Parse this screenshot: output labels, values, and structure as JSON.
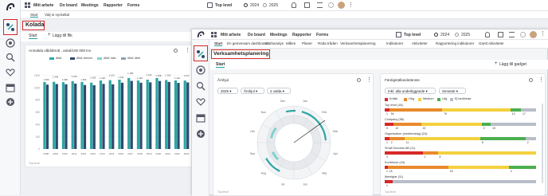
{
  "colors": {
    "teal": "#2ca6a4",
    "teal_light": "#7fd3cf",
    "navy": "#2f4a6d",
    "grey": "#8da0b8",
    "red": "#d62828",
    "yellow": "#f4d03f",
    "orange": "#e98a2c",
    "green": "#4caf50",
    "bar_grey": "#b7bec8"
  },
  "back_window": {
    "nav": [
      "Mitt arbete",
      "Do board",
      "Meetings",
      "Rapporter",
      "Forms"
    ],
    "top_level": "Top level",
    "year_a": "2024",
    "year_b": "2025",
    "tabs": [
      "Start",
      "Välj in nyckeltal"
    ],
    "kolada_label": "Kolada",
    "start_tab": "Start",
    "add_tile": "Lägg till flik",
    "chart_title": "Anmälda våldsbrott , antal/100 000 inv",
    "chart_footer": "Top level",
    "legend": [
      "Alla1",
      "Alla1 kvinnor",
      "Alla1 män",
      "Alla1 diver"
    ]
  },
  "chart_data": {
    "type": "bar",
    "title": "Anmälda våldsbrott , antal/100 000 inv",
    "categories": [
      "2008",
      "2009",
      "2010",
      "2011",
      "2012",
      "2013",
      "2014",
      "2015",
      "2016",
      "2017",
      "2018",
      "2019",
      "2020",
      "2021",
      "2022",
      "2023"
    ],
    "series": [
      {
        "name": "Alla1",
        "values": [
          1093,
          1096,
          1090,
          1105,
          1094,
          1083,
          1118,
          1123,
          1131,
          1158,
          1118,
          1131,
          1158,
          1126,
          1119,
          1117
        ]
      },
      {
        "name": "Alla1 kvinnor",
        "values": [
          1050,
          1060,
          1056,
          1067,
          1044,
          1040,
          1062,
          1055,
          1081,
          1111,
          1081,
          1087,
          1110,
          1094,
          1078,
          1086
        ]
      }
    ],
    "data_labels": [
      "1 093",
      "1 096",
      "1 090",
      "1 105",
      "1 094",
      "1 083",
      "1 118",
      "1 123",
      "1 131",
      "1 158",
      "1 118",
      "1 131",
      "1 158",
      "1 126",
      "1 119",
      "1 117"
    ],
    "ylim": [
      0,
      1300
    ],
    "grid": true,
    "legend": "top"
  },
  "front_window": {
    "nav": [
      "Mitt arbete",
      "Do board",
      "Meetings",
      "Rapporter",
      "Forms"
    ],
    "top_level": "Top level",
    "year_a": "2024",
    "year_b": "2025",
    "tabs": [
      "Start",
      "En gemensam dashboard",
      "Mathanalys",
      "Målen",
      "Planer",
      "Röda tråden",
      "Verksamhetsplanering",
      "Indikatorer",
      "Aktiviteter",
      "Rapportering indikatorer",
      "Gantt Aktiviteter"
    ],
    "verksamhet_label": "Verksamhetsplanering",
    "start_tab": "Start",
    "add_gadget": "Lägg till gadget",
    "arshjul": {
      "title": "Årshjul",
      "sel_year": "2025",
      "sel_type": "Årshjul",
      "sel_count": "2 valda",
      "months": [
        "Jan",
        "Feb",
        "Mar",
        "Apr",
        "Maj",
        "Jun",
        "Jul",
        "Aug",
        "Sep",
        "Okt",
        "Nov",
        "Dec"
      ],
      "footer": "Top level"
    },
    "fardig": {
      "title": "Färdigställandetänste",
      "filter_units": "Inkl. alla underliggande",
      "filter_period": "Senaste",
      "legend": [
        "Kritisk",
        "Hög",
        "Medium",
        "Låg",
        "Ej bedömda"
      ],
      "rows": [
        {
          "label": "Top level (18)",
          "counts": [
            "1",
            "54",
            "79",
            "13",
            "17"
          ]
        },
        {
          "label": "Company (58)",
          "counts": [
            "5",
            "12",
            "22",
            "3",
            "15"
          ]
        },
        {
          "label": "Organization (medlemslag) (24)",
          "counts": [
            "1",
            "2",
            "11",
            "8",
            "2"
          ]
        },
        {
          "label": "Small Success AB (11)",
          "counts": [
            "3",
            "1",
            "8"
          ]
        },
        {
          "label": "Kontrhuse (44)",
          "counts": [
            "1",
            "18",
            "18",
            "4"
          ]
        },
        {
          "label": "Mentiglar (11)",
          "counts": [
            "1"
          ]
        }
      ],
      "footer": "Top level"
    }
  }
}
